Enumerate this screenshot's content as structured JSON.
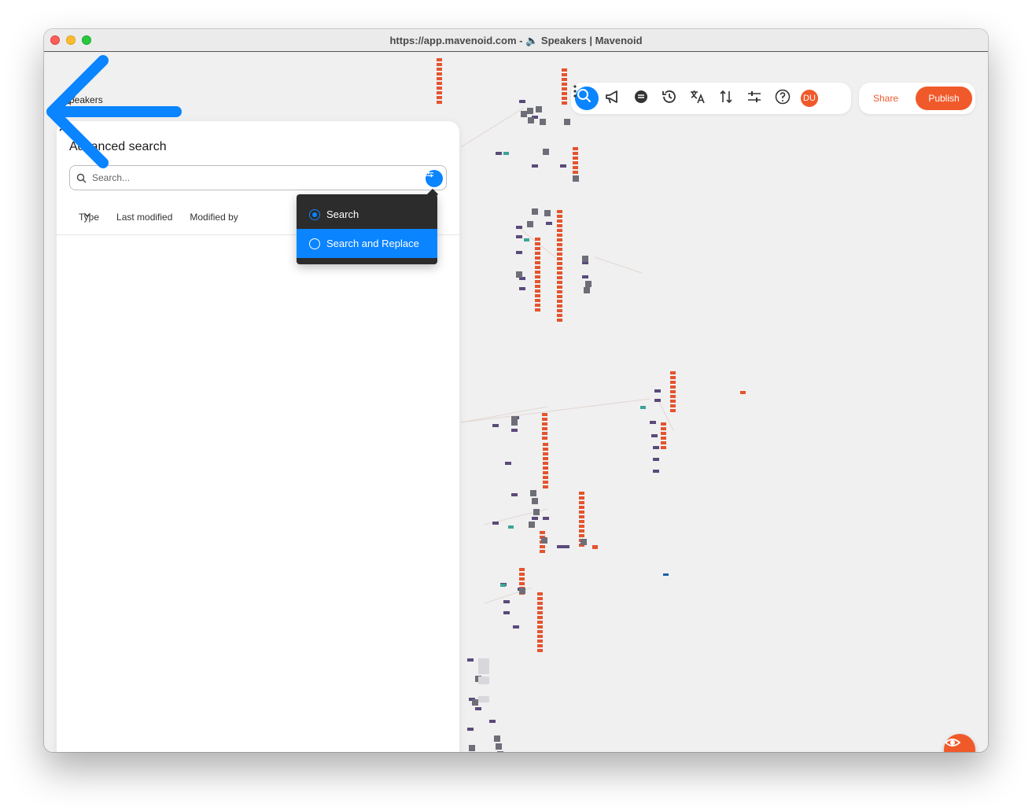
{
  "window": {
    "title": "https://app.mavenoid.com - 🔈 Speakers | Mavenoid"
  },
  "breadcrumb": {
    "home_icon": "home-icon",
    "separator_icon": "chevron-right-icon",
    "current": "Speakers",
    "current_icon": "speaker-icon"
  },
  "toolbar": {
    "icons": [
      "search-icon",
      "megaphone-icon",
      "chat-icon",
      "history-icon",
      "translate-icon",
      "sort-icon",
      "settings-sliders-icon",
      "help-icon"
    ],
    "avatar_initials": "DU",
    "more_icon": "kebab-icon"
  },
  "actions": {
    "share_label": "Share",
    "publish_label": "Publish"
  },
  "advanced_search": {
    "title": "Advanced search",
    "search_placeholder": "Search...",
    "filters": [
      {
        "label": "Type"
      },
      {
        "label": "Last modified"
      },
      {
        "label": "Modified by"
      }
    ],
    "mode_menu": {
      "options": [
        {
          "label": "Search",
          "selected": true
        },
        {
          "label": "Search and Replace",
          "selected": false
        }
      ],
      "highlighted": "Search and Replace"
    }
  },
  "colors": {
    "accent_blue": "#0a84ff",
    "brand_orange": "#f05a2b",
    "canvas": "#f0f0f0",
    "node_red": "#e4542e",
    "node_purple": "#5a4a7a",
    "node_gray": "#6e6e78",
    "node_teal": "#3aa597"
  },
  "preview_icon": "eye-icon"
}
